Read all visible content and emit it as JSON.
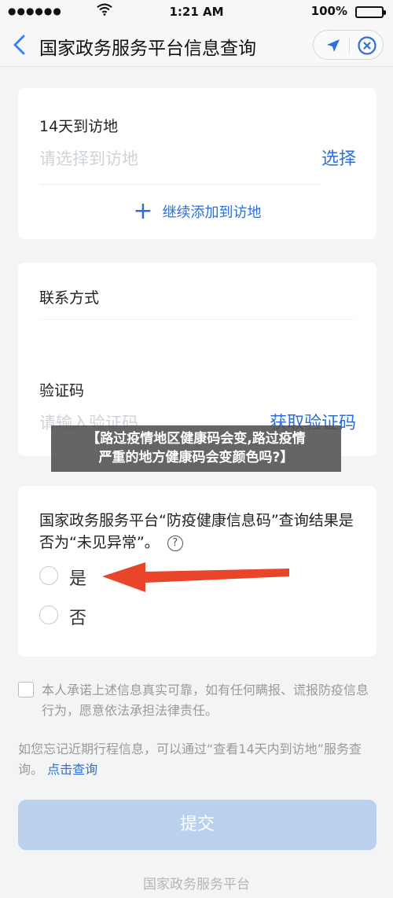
{
  "status_bar": {
    "time": "1:21 AM",
    "battery": "100%"
  },
  "nav": {
    "title": "国家政务服务平台信息查询"
  },
  "visit": {
    "label": "14天到访地",
    "placeholder": "请选择到访地",
    "select_btn": "选择",
    "add_more": "继续添加到访地"
  },
  "contact": {
    "label": "联系方式",
    "code_label": "验证码",
    "code_placeholder": "请输入验证码",
    "get_code_btn": "获取验证码"
  },
  "banner": {
    "line1": "【路过疫情地区健康码会变,路过疫情",
    "line2": "严重的地方健康码会变颜色吗?】"
  },
  "question": {
    "text": "国家政务服务平台“防疫健康信息码”查询结果是否为“未见异常”。",
    "help": "?",
    "options": [
      "是",
      "否"
    ]
  },
  "agreement": {
    "text": "本人承诺上述信息真实可靠，如有任何瞒报、谎报防疫信息行为，愿意依法承担法律责任。"
  },
  "hint": {
    "text": "如您忘记近期行程信息，可以通过“查看14天内到访地”服务查询。",
    "link": "点击查询"
  },
  "submit_label": "提交",
  "footer": "国家政务服务平台",
  "colors": {
    "primary": "#2f6fd6",
    "annotation_arrow": "#e8452a",
    "submit_disabled": "#b9d0ef"
  }
}
